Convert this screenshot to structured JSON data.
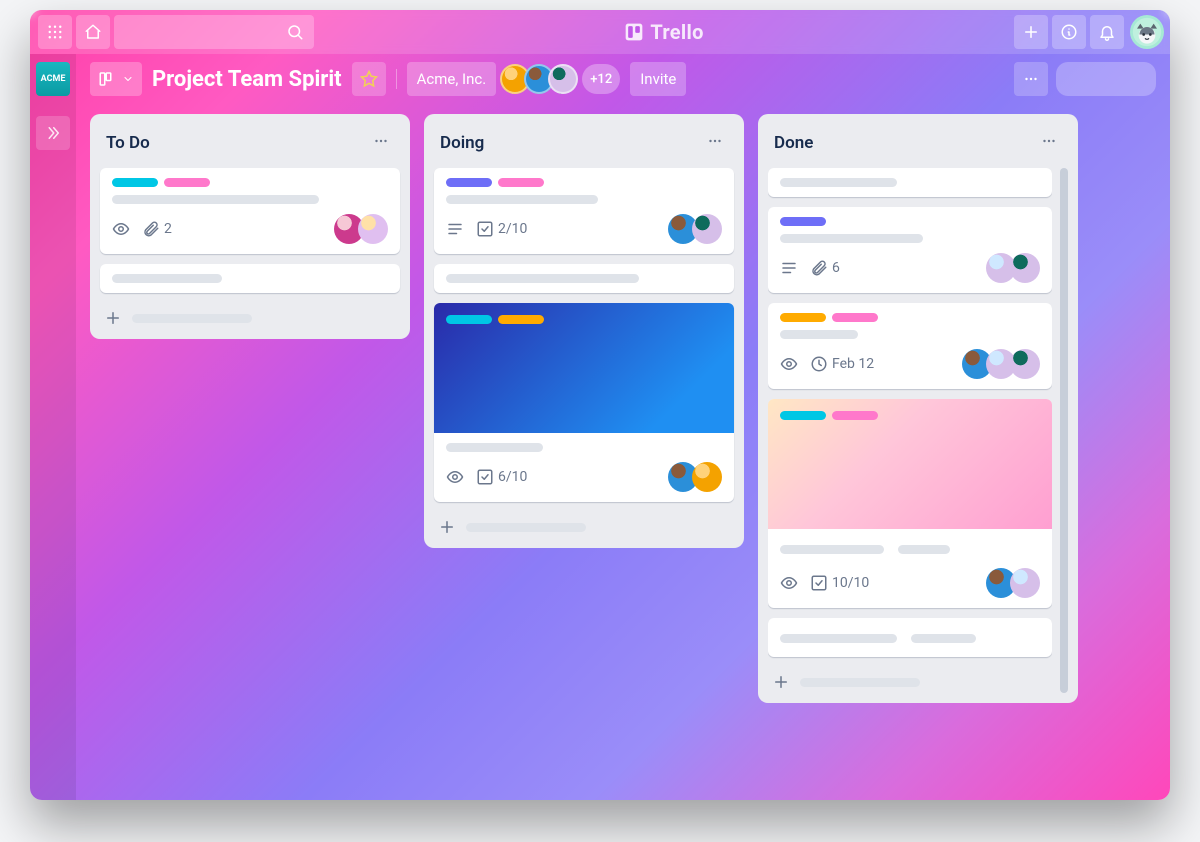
{
  "brand": "Trello",
  "workspace_logo_text": "ACME",
  "board": {
    "title": "Project Team Spirit",
    "workspace": "Acme, Inc.",
    "invite": "Invite",
    "extra_members": "+12"
  },
  "lists": [
    {
      "title": "To Do",
      "cards": [
        {
          "attachments": "2"
        }
      ]
    },
    {
      "title": "Doing",
      "cards": [
        {
          "checklist": "2/10"
        },
        {
          "checklist": "6/10"
        }
      ]
    },
    {
      "title": "Done",
      "cards": [
        {
          "attachments": "6"
        },
        {
          "date": "Feb 12"
        },
        {
          "checklist": "10/10"
        }
      ]
    }
  ]
}
